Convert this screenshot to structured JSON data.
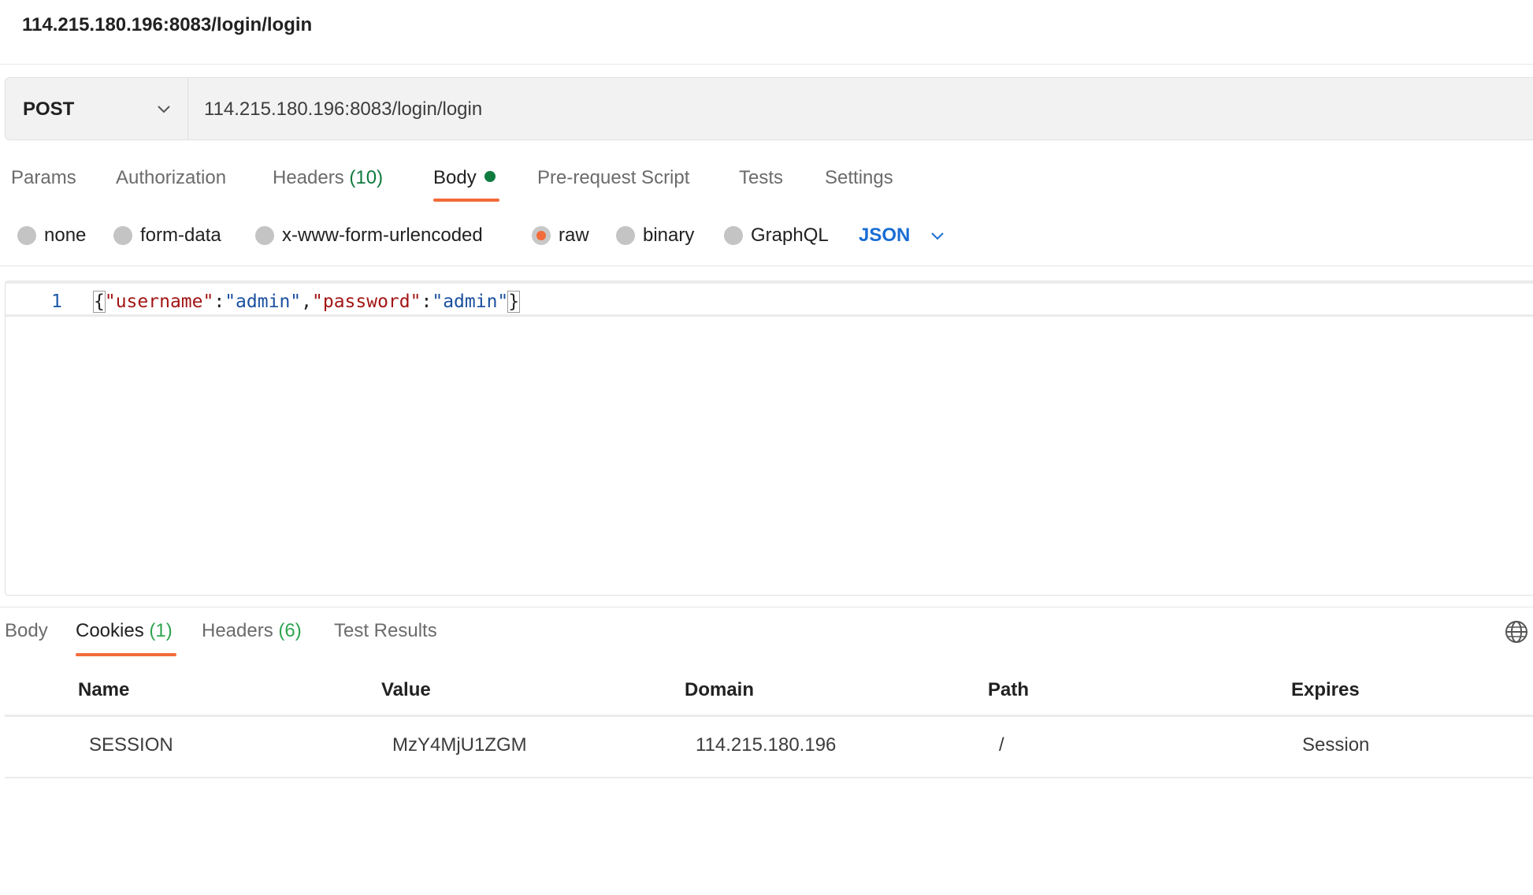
{
  "window": {
    "title": "114.215.180.196:8083/login/login"
  },
  "request": {
    "method": "POST",
    "url": "114.215.180.196:8083/login/login",
    "tabs": [
      {
        "label": "Params"
      },
      {
        "label": "Authorization"
      },
      {
        "label": "Headers",
        "count": "(10)"
      },
      {
        "label": "Body",
        "active": true
      },
      {
        "label": "Pre-request Script"
      },
      {
        "label": "Tests"
      },
      {
        "label": "Settings"
      }
    ],
    "body_types": [
      {
        "label": "none"
      },
      {
        "label": "form-data"
      },
      {
        "label": "x-www-form-urlencoded"
      },
      {
        "label": "raw",
        "selected": true
      },
      {
        "label": "binary"
      },
      {
        "label": "GraphQL"
      }
    ],
    "body_language": "JSON",
    "editor": {
      "line_number": "1",
      "open_brace": "{",
      "key1": "\"username\"",
      "colon": ":",
      "value1": "\"admin\"",
      "comma": ",",
      "key2": "\"password\"",
      "value2": "\"admin\"",
      "close_brace": "}"
    }
  },
  "response": {
    "tabs": [
      {
        "label": "Body"
      },
      {
        "label": "Cookies",
        "count": "(1)",
        "active": true
      },
      {
        "label": "Headers",
        "count": "(6)"
      },
      {
        "label": "Test Results"
      }
    ],
    "cookies": {
      "columns": [
        "Name",
        "Value",
        "Domain",
        "Path",
        "Expires"
      ],
      "rows": [
        [
          "SESSION",
          "MzY4MjU1ZGM",
          "114.215.180.196",
          "/",
          "Session"
        ]
      ]
    }
  },
  "colors": {
    "accent": "#f26b3a",
    "count_green": "#0f7b3f",
    "link_blue": "#1a6dd4",
    "json_key": "#a31515",
    "json_string": "#1a50a0"
  },
  "icons": [
    "chevron-down-icon",
    "dot-indicator-icon",
    "globe-icon"
  ]
}
